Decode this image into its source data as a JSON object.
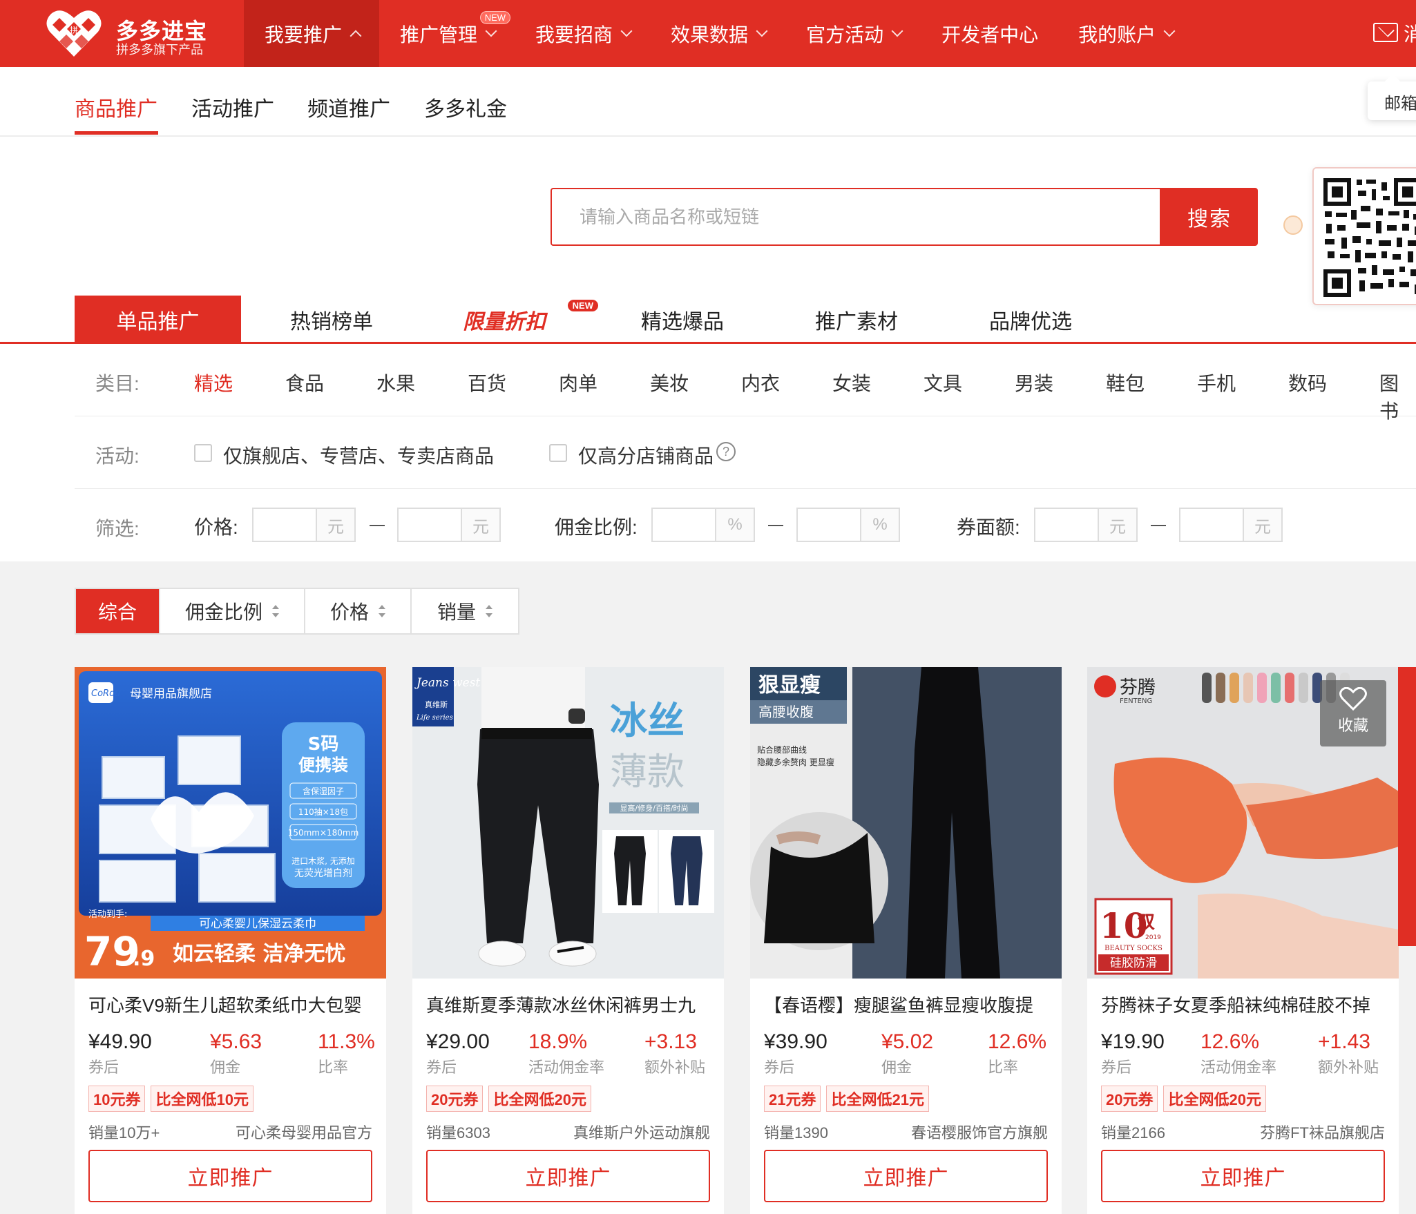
{
  "header": {
    "brand_title": "多多进宝",
    "brand_sub": "拼多多旗下产品",
    "logo_char": "拼",
    "nav": [
      {
        "label": "我要推广",
        "active": true
      },
      {
        "label": "推广管理",
        "badge": "NEW"
      },
      {
        "label": "我要招商"
      },
      {
        "label": "效果数据"
      },
      {
        "label": "官方活动"
      },
      {
        "label": "开发者中心"
      },
      {
        "label": "我的账户"
      }
    ],
    "mail_label": "消",
    "mail_tooltip": "邮箱"
  },
  "subnav": [
    "商品推广",
    "活动推广",
    "频道推广",
    "多多礼金"
  ],
  "search": {
    "placeholder": "请输入商品名称或短链",
    "button": "搜索"
  },
  "promo_tabs": [
    "单品推广",
    "热销榜单",
    "限量折扣",
    "精选爆品",
    "推广素材",
    "品牌优选"
  ],
  "promo_tab_badge": "NEW",
  "filters": {
    "category_label": "类目:",
    "categories": [
      "精选",
      "食品",
      "水果",
      "百货",
      "肉单",
      "美妆",
      "内衣",
      "女装",
      "文具",
      "男装",
      "鞋包",
      "手机",
      "数码",
      "图书"
    ],
    "activity_label": "活动:",
    "activity_options": [
      "仅旗舰店、专营店、专卖店商品",
      "仅高分店铺商品"
    ],
    "screen_label": "筛选:",
    "price_label": "价格:",
    "commission_label": "佣金比例:",
    "coupon_label": "券面额:",
    "unit_yuan": "元",
    "unit_percent": "%",
    "help_glyph": "?"
  },
  "sort": [
    "综合",
    "佣金比例",
    "价格",
    "销量"
  ],
  "products": [
    {
      "title": "可心柔V9新生儿超软柔纸巾大包婴",
      "price": "¥49.90",
      "price_label": "券后",
      "mid_value": "¥5.63",
      "mid_label": "佣金",
      "right_value": "11.3%",
      "right_label": "比率",
      "tags": [
        "10元券",
        "比全网低10元"
      ],
      "sales": "销量10万+",
      "shop": "可心柔母婴用品官方",
      "button": "立即推广",
      "img": {
        "store": "母婴用品旗舰店",
        "brand": "CoRou",
        "badge_top": "S码",
        "badge_bottom": "便携装",
        "badge_lines": [
          "含保湿因子",
          "110抽×18包",
          "150mm×180mm"
        ],
        "badge_notes": [
          "进口木浆, 无添加",
          "无荧光增白剂"
        ],
        "banner": "可心柔婴儿保湿云柔巾",
        "act_label": "活动到手:",
        "price_big": "79",
        "price_small": ".9",
        "slogan": "如云轻柔 洁净无忧"
      }
    },
    {
      "title": "真维斯夏季薄款冰丝休闲裤男士九",
      "price": "¥29.00",
      "price_label": "券后",
      "mid_value": "18.9%",
      "mid_label": "活动佣金率",
      "right_value": "+3.13",
      "right_label": "额外补贴",
      "tags": [
        "20元券",
        "比全网低20元"
      ],
      "sales": "销量6303",
      "shop": "真维斯户外运动旗舰",
      "button": "立即推广",
      "img": {
        "brand": "Jeans west",
        "brand_cn": "真维斯",
        "brand_sub": "Life series",
        "big1": "冰丝",
        "big2": "薄款",
        "caption": "显高/修身/百搭/时尚"
      }
    },
    {
      "title": "【春语樱】瘦腿鲨鱼裤显瘦收腹提",
      "price": "¥39.90",
      "price_label": "券后",
      "mid_value": "¥5.02",
      "mid_label": "佣金",
      "right_value": "12.6%",
      "right_label": "比率",
      "tags": [
        "21元券",
        "比全网低21元"
      ],
      "sales": "销量1390",
      "shop": "春语樱服饰官方旗舰",
      "button": "立即推广",
      "img": {
        "head": "狠显瘦",
        "sub": "高腰收腹",
        "note1": "贴合腰部曲线",
        "note2": "隐藏多余赘肉 更显瘦"
      }
    },
    {
      "title": "芬腾袜子女夏季船袜纯棉硅胶不掉",
      "price": "¥19.90",
      "price_label": "券后",
      "mid_value": "12.6%",
      "mid_label": "活动佣金率",
      "right_value": "+1.43",
      "right_label": "额外补贴",
      "tags": [
        "20元券",
        "比全网低20元"
      ],
      "sales": "销量2166",
      "shop": "芬腾FT袜品旗舰店",
      "button": "立即推广",
      "img": {
        "brand_cn": "芬腾",
        "brand_en": "FENTENG",
        "count": "10",
        "unit": "双",
        "year": "2019",
        "en": "BEAUTY SOCKS",
        "cn": "硅胶防滑"
      }
    }
  ],
  "favorite_label": "收藏"
}
